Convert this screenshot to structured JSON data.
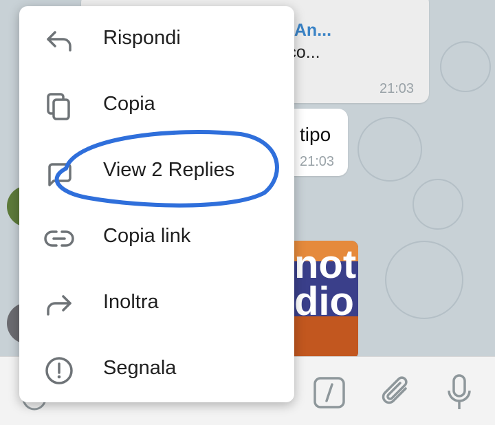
{
  "chat": {
    "link_message": {
      "title": "Anti-OctoAn...",
      "url": "n.mihoyo.co...",
      "time": "21:03"
    },
    "text_message": {
      "text": "tipo",
      "time": "21:03"
    },
    "photo_message": {
      "overlay_text": "not\ndio"
    }
  },
  "context_menu": {
    "items": [
      {
        "label": "Rispondi",
        "icon": "reply-icon"
      },
      {
        "label": "Copia",
        "icon": "copy-icon"
      },
      {
        "label": "View 2 Replies",
        "icon": "replies-icon"
      },
      {
        "label": "Copia link",
        "icon": "link-icon"
      },
      {
        "label": "Inoltra",
        "icon": "forward-icon"
      },
      {
        "label": "Segnala",
        "icon": "report-icon"
      }
    ]
  },
  "input_bar": {
    "icons": [
      "emoji-icon",
      "commands-icon",
      "attach-icon",
      "mic-icon"
    ]
  },
  "colors": {
    "accent": "#3a83c6",
    "annotation": "#2f6fdb",
    "chat_background": "#c8d1d6"
  }
}
